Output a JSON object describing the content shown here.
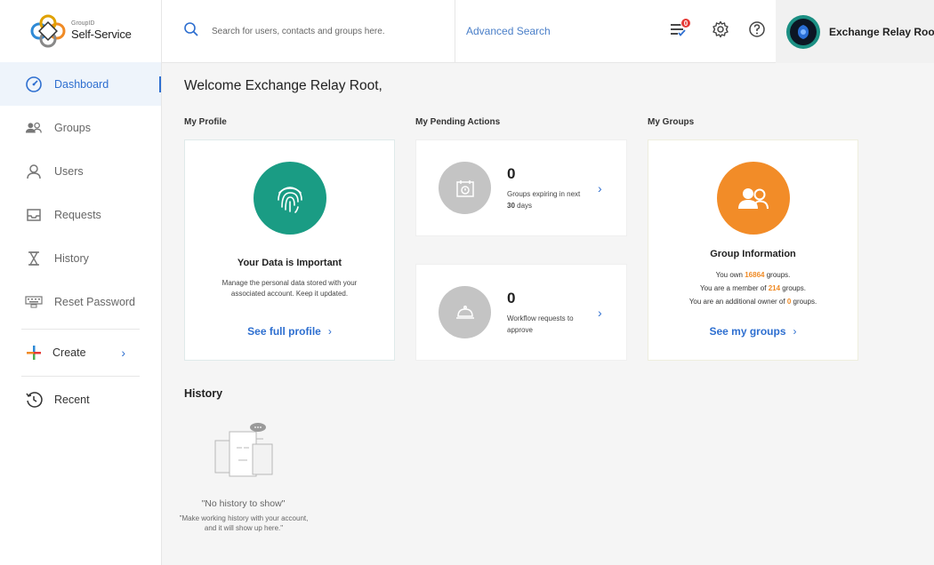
{
  "app": {
    "logo_small": "GroupID",
    "logo_main": "Self-Service"
  },
  "sidebar": {
    "items": [
      {
        "label": "Dashboard",
        "icon": "dashboard-icon",
        "active": true
      },
      {
        "label": "Groups",
        "icon": "groups-icon"
      },
      {
        "label": "Users",
        "icon": "user-icon"
      },
      {
        "label": "Requests",
        "icon": "inbox-icon"
      },
      {
        "label": "History",
        "icon": "hourglass-icon"
      },
      {
        "label": "Reset Password",
        "icon": "keyboard-icon"
      }
    ],
    "create_label": "Create",
    "recent_label": "Recent"
  },
  "header": {
    "search_placeholder": "Search for users, contacts and groups here.",
    "advanced_search": "Advanced Search",
    "notification_count": "0",
    "user_name": "Exchange Relay Root"
  },
  "main": {
    "welcome": "Welcome Exchange Relay Root,",
    "sections": {
      "profile": "My Profile",
      "pending": "My Pending Actions",
      "groups": "My Groups"
    },
    "profile_card": {
      "title": "Your Data is Important",
      "desc": "Manage the personal data stored with your associated account. Keep it updated.",
      "link": "See full profile"
    },
    "pending_actions": [
      {
        "count": "0",
        "text": "Groups expiring in next",
        "emph": "30",
        "suffix": "days"
      },
      {
        "count": "0",
        "text": "Workflow requests to approve"
      }
    ],
    "groups_card": {
      "title": "Group Information",
      "line1_pre": "You own ",
      "line1_val": "16864",
      "line1_post": " groups.",
      "line2_pre": "You are a member of ",
      "line2_val": "214",
      "line2_post": " groups.",
      "line3_pre": "You are an additional owner of ",
      "line3_val": "0",
      "line3_post": " groups.",
      "link": "See my groups"
    },
    "history": {
      "title": "History",
      "empty_main": "\"No history to show\"",
      "empty_sub": "\"Make working history with your account, and it will show up here.\""
    }
  },
  "colors": {
    "accent": "#2e6fd0",
    "profile_circle": "#1a9c84",
    "groups_circle": "#f28c28",
    "pending_circle": "#c4c4c4",
    "badge": "#e53935"
  }
}
